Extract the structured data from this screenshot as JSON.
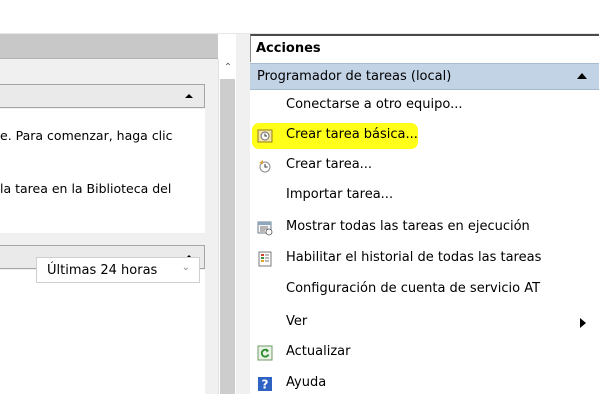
{
  "left_panel": {
    "section1": {
      "text_line1": "e. Para comenzar, haga clic",
      "text_line2": "la tarea en la Biblioteca del"
    },
    "section2": {
      "dropdown_value": "Últimas 24 horas"
    }
  },
  "actions": {
    "title": "Acciones",
    "group_label": "Programador de tareas (local)",
    "items": [
      {
        "label": "Conectarse a otro equipo...",
        "icon": ""
      },
      {
        "label": "Crear tarea básica...",
        "icon": "basic-task-wizard-icon",
        "highlighted": true
      },
      {
        "label": "Crear tarea...",
        "icon": "create-task-icon"
      },
      {
        "label": "Importar tarea...",
        "icon": ""
      },
      {
        "label": "Mostrar todas las tareas en ejecución",
        "icon": "running-tasks-icon"
      },
      {
        "label": "Habilitar el historial de todas las tareas",
        "icon": "history-icon"
      },
      {
        "label": "Configuración de cuenta de servicio AT",
        "icon": ""
      },
      {
        "label": "Ver",
        "icon": "",
        "has_submenu": true
      },
      {
        "label": "Actualizar",
        "icon": "refresh-icon"
      },
      {
        "label": "Ayuda",
        "icon": "help-icon"
      }
    ]
  },
  "colors": {
    "group_header_bg": "#c2d3e6",
    "highlight": "#ffff19",
    "pane_bg": "#f0f0f0"
  }
}
